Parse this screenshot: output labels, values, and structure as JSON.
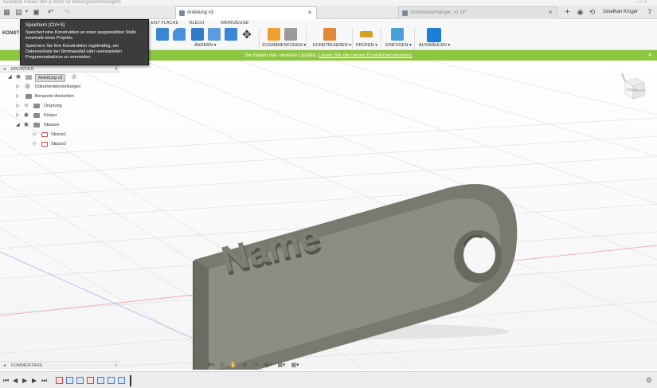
{
  "window": {
    "title": "Autodesk Fusion 360 (Lizenz für Bildungseinrichtungen)",
    "controls": "– ☐ ✕"
  },
  "tabs": [
    {
      "label": "Anleitung v3",
      "close": "✕",
      "active": true
    },
    {
      "label": "Schlüsselanhänger_v1 v3*",
      "close": "✕",
      "active": false
    }
  ],
  "user": {
    "name": "Jonathan Krüger"
  },
  "toolbar": {
    "workspace": "KONST",
    "tool_tabs": [
      "ENT FLÄCHE",
      "BLECH",
      "WERKZEUGE"
    ],
    "groups": [
      {
        "label": "ÄNDERN ▾"
      },
      {
        "label": "ZUSAMMENFÜGEN ▾"
      },
      {
        "label": "KONSTRUIEREN ▾"
      },
      {
        "label": "PRÜFEN ▾"
      },
      {
        "label": "EINFÜGEN ▾"
      },
      {
        "label": "AUSWÄHLEN ▾"
      }
    ]
  },
  "tooltip": {
    "title": "Speichern (Ctrl+S)",
    "paragraph1": "Speichert eine Konstruktion an einer ausgewählten Stelle innerhalb eines Projekts.",
    "paragraph2": "Speichern Sie Ihre Konstruktion regelmäßig, um Datenverluste bei Stromausfall oder unerwarteten Programmabstürze zu vermeiden."
  },
  "banner": {
    "text": "Sie haben das neueste Update.",
    "link": "Lesen Sie die neuen Funktionen kennen.",
    "close": "✕",
    "color": "#8dc63f"
  },
  "browser": {
    "title": "BROWSER",
    "collapse": "◂",
    "pin": "‖",
    "root": "Anleitung v3",
    "items": [
      {
        "label": "Dokumenteinstellungen"
      },
      {
        "label": "Benannte Ansichten"
      },
      {
        "label": "Ursprung"
      },
      {
        "label": "Körper"
      },
      {
        "label": "Skizzen"
      },
      {
        "label": "Skizze1"
      },
      {
        "label": "Skizze2"
      }
    ]
  },
  "model": {
    "text": "Name"
  },
  "viewcube": {
    "front": "FRONT",
    "right": "RECHTS",
    "top": "OBEN"
  },
  "comments": {
    "title": "KOMMENTARE",
    "collapse": "◂",
    "add": "+"
  },
  "navbar": {
    "glyphs": [
      "✥▾",
      "⎘",
      "✋",
      "⊕",
      "⌕▾",
      "▣▾",
      "▦▾",
      "▦▾"
    ]
  },
  "timeline": {
    "controls": [
      "⏮",
      "◀",
      "▶",
      "▶",
      "⏭"
    ],
    "settings": "⚙"
  }
}
